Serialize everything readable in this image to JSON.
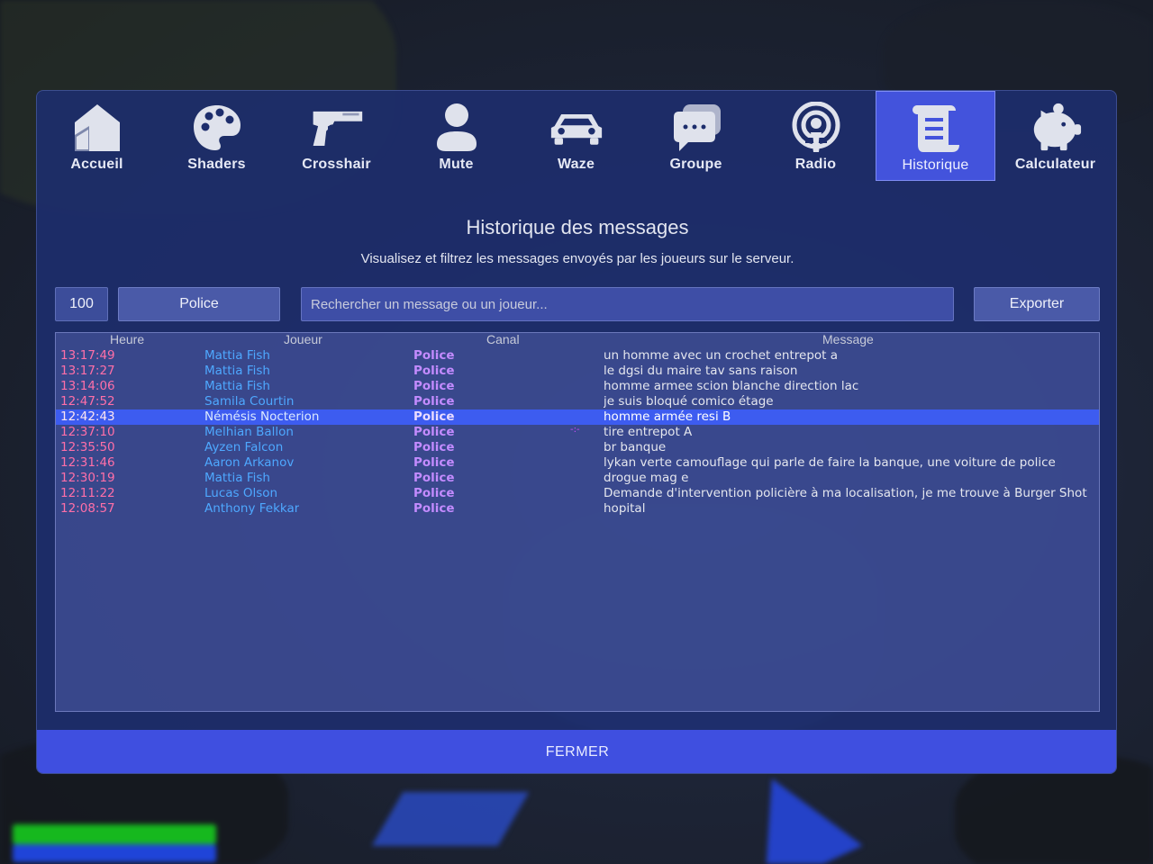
{
  "nav": {
    "items": [
      {
        "label": "Accueil",
        "icon": "home-icon"
      },
      {
        "label": "Shaders",
        "icon": "palette-icon"
      },
      {
        "label": "Crosshair",
        "icon": "pistol-icon"
      },
      {
        "label": "Mute",
        "icon": "user-icon"
      },
      {
        "label": "Waze",
        "icon": "car-icon"
      },
      {
        "label": "Groupe",
        "icon": "chat-icon"
      },
      {
        "label": "Radio",
        "icon": "podcast-icon"
      },
      {
        "label": "Historique",
        "icon": "scroll-icon"
      },
      {
        "label": "Calculateur",
        "icon": "piggy-bank-icon"
      }
    ],
    "active": "Historique"
  },
  "header": {
    "title": "Historique des messages",
    "subtitle": "Visualisez et filtrez les messages envoyés par les joueurs sur le serveur."
  },
  "controls": {
    "limit": "100",
    "channel": "Police",
    "search_placeholder": "Rechercher un message ou un joueur...",
    "export_label": "Exporter"
  },
  "table": {
    "columns": [
      "Heure",
      "Joueur",
      "Canal",
      "Message"
    ],
    "rows": [
      {
        "time": "13:17:49",
        "player": "Mattia Fish",
        "canal": "Police",
        "message": "un homme avec un crochet entrepot a"
      },
      {
        "time": "13:17:27",
        "player": "Mattia Fish",
        "canal": "Police",
        "message": "le dgsi du maire tav sans raison"
      },
      {
        "time": "13:14:06",
        "player": "Mattia Fish",
        "canal": "Police",
        "message": "homme armee scion blanche direction lac"
      },
      {
        "time": "12:47:52",
        "player": "Samila Courtin",
        "canal": "Police",
        "message": "je suis bloqué comico étage"
      },
      {
        "time": "12:42:43",
        "player": "Némésis Nocterion",
        "canal": "Police",
        "message": "homme armée resi B"
      },
      {
        "time": "12:37:10",
        "player": "Melhian Ballon",
        "canal": "Police",
        "message": "tire entrepot A"
      },
      {
        "time": "12:35:50",
        "player": "Ayzen Falcon",
        "canal": "Police",
        "message": "br banque"
      },
      {
        "time": "12:31:46",
        "player": "Aaron Arkanov",
        "canal": "Police",
        "message": "lykan verte camouflage qui parle de faire la banque, une voiture de police"
      },
      {
        "time": "12:30:19",
        "player": "Mattia Fish",
        "canal": "Police",
        "message": "drogue mag e"
      },
      {
        "time": "12:11:22",
        "player": "Lucas Olson",
        "canal": "Police",
        "message": "Demande d'intervention policière à ma localisation, je me trouve à Burger Shot"
      },
      {
        "time": "12:08:57",
        "player": "Anthony Fekkar",
        "canal": "Police",
        "message": "hopital"
      }
    ],
    "selected_index": 4
  },
  "footer": {
    "close_label": "FERMER"
  },
  "colors": {
    "panel": "#1d2d6c",
    "accent": "#4353dc",
    "time": "#ff6fa8",
    "player": "#4ea8ff",
    "canal": "#c38bff"
  }
}
